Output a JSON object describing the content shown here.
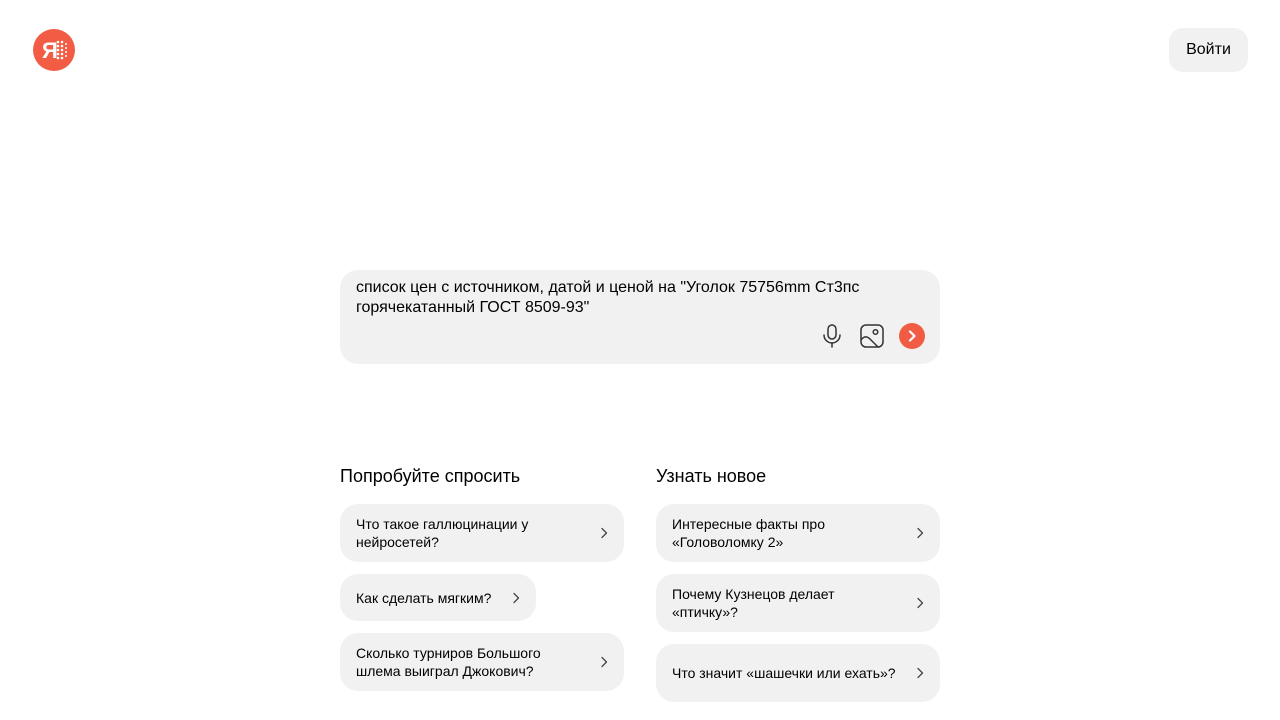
{
  "header": {
    "logo_icon": "yandex-ya-logo",
    "login_label": "Войти"
  },
  "search": {
    "query": "список цен с источником, датой и ценой на \"Уголок 75756mm Ст3пс горячекатанный ГОСТ 8509-93\"",
    "icons": [
      "microphone-icon",
      "image-icon",
      "send-arrow-icon"
    ]
  },
  "try_asking": {
    "title": "Попробуйте спросить",
    "items": [
      {
        "label": "Что такое галлюцинации у нейросетей?"
      },
      {
        "label": "Как сделать мягким?"
      },
      {
        "label": "Сколько турниров Большого шлема выиграл Джокович?"
      }
    ]
  },
  "learn_new": {
    "title": "Узнать новое",
    "items": [
      {
        "label": "Интересные факты про «Головоломку 2»"
      },
      {
        "label": "Почему Кузнецов делает «птичку»?"
      },
      {
        "label": "Что значит «шашечки или ехать»?"
      }
    ]
  },
  "colors": {
    "accent": "#f25c45",
    "surface": "#f1f1f1"
  }
}
